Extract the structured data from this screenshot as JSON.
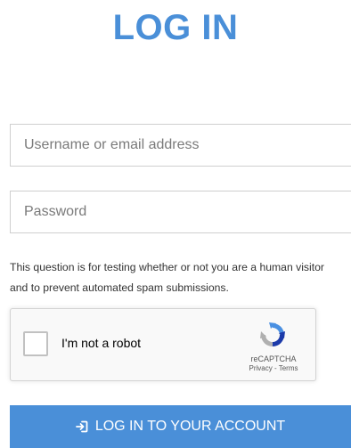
{
  "page": {
    "title": "LOG IN"
  },
  "form": {
    "username_placeholder": "Username or email address",
    "username_value": "",
    "password_placeholder": "Password",
    "password_value": "",
    "captcha_description": "This question is for testing whether or not you are a human visitor and to prevent automated spam submissions."
  },
  "recaptcha": {
    "checkbox_label": "I'm not a robot",
    "checked": false,
    "brand": "reCAPTCHA",
    "privacy_link": "Privacy",
    "separator": " - ",
    "terms_link": "Terms",
    "logo_icon": "recaptcha-logo-icon"
  },
  "submit": {
    "label": "LOG IN TO YOUR ACCOUNT",
    "icon": "sign-in-icon"
  },
  "colors": {
    "accent": "#4a8fd8",
    "button_text": "#ffffff",
    "border": "#cfcfcf",
    "recaptcha_bg": "#f9f9f9"
  }
}
